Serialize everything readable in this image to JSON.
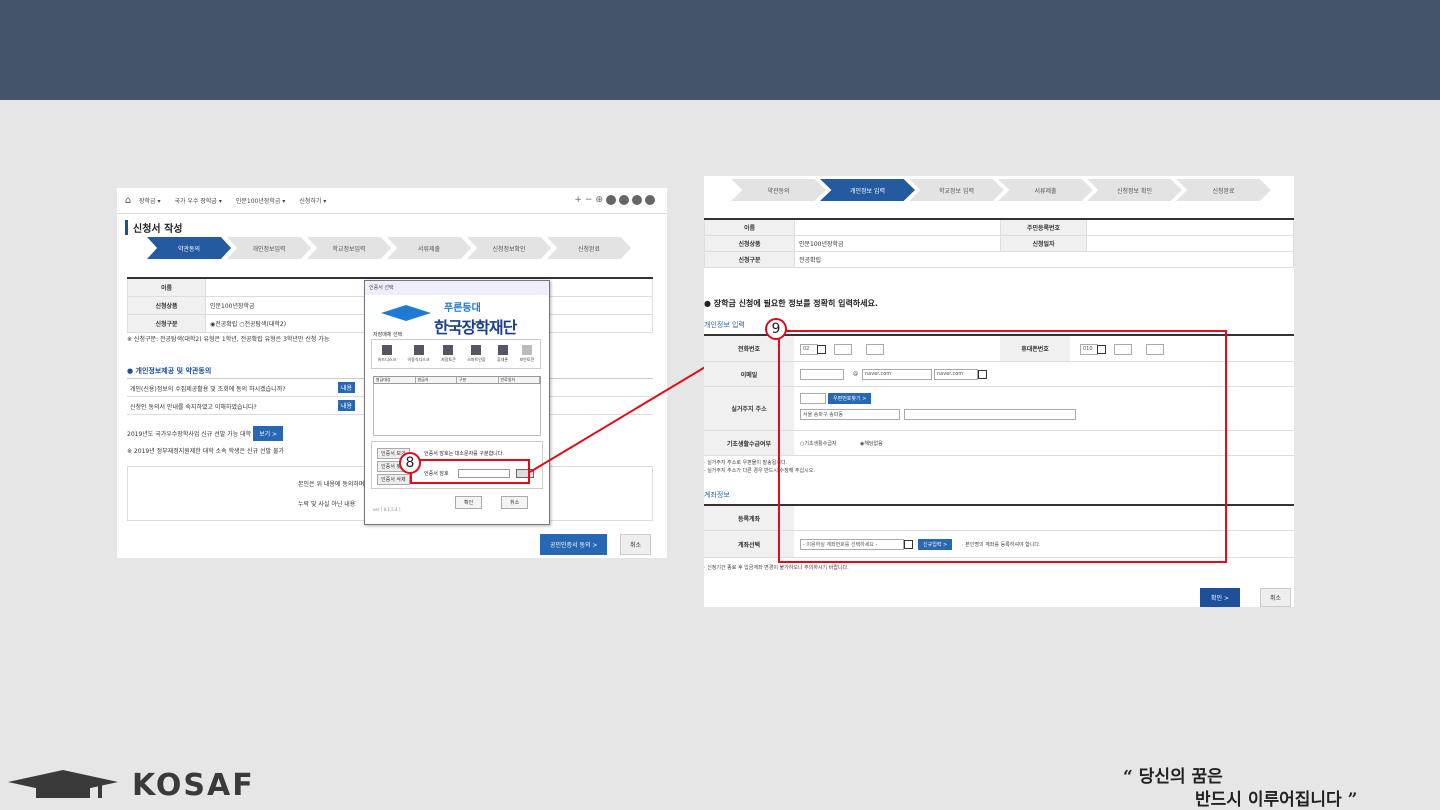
{
  "left_panel": {
    "breadcrumb": [
      "장학금 ▾",
      "국가 우수 장학금 ▾",
      "인문100년장학금 ▾",
      "신청하기 ▾"
    ],
    "crumb_icons": [
      "+",
      "−",
      "⊕"
    ],
    "title": "신청서 작성",
    "steps": [
      "약관동의",
      "개인정보입력",
      "학교정보입력",
      "서류제출",
      "신청정보확인",
      "신청완료"
    ],
    "table": [
      {
        "label": "이름",
        "value": ""
      },
      {
        "label": "신청상품",
        "value": "인문100년장학금"
      },
      {
        "label": "신청구분",
        "value": "◉전공확립 ○전공탐색(대학2)"
      }
    ],
    "note": "※ 신청구분: 전공탐색(대학2) 유형은 1학년, 전공확립 유형은 3학년만 신청 가능",
    "section": "개인정보제공 및 약관동의",
    "agree_rows": [
      "개인(신용)정보의 수집제공활용 및 조회에 동의 하시겠습니까?",
      "신청인 동의서 안내를 숙지하였고 이해하였습니다?"
    ],
    "agree_btn": "내용",
    "note2": "2019년도 국가우수장학사업 신규 선발 가능 대학",
    "view_btn": "보기 >",
    "note3": "※ 2019년 정부재정지원제한 대학 소속 학생은 신규 선발 불가",
    "box_line1": "본인은 위 내용에 동의하며 신청서",
    "box_line2": "누락 및 사실 아닌 내용",
    "cert_btn": "공인인증서 동의 >",
    "cancel_btn": "취소"
  },
  "dialog": {
    "title": "인증서 선택",
    "logo_line1": "푸른등대",
    "logo_line2": "한국장학재단",
    "group_label": "저장매체 선택",
    "devices": [
      "하드디스크",
      "이동식디스크",
      "저장토큰",
      "스마트인증",
      "휴대폰",
      "보안토큰"
    ],
    "columns": [
      "발급대상",
      "발급자",
      "구분",
      "만료일자"
    ],
    "pw_buttons": [
      "인증서 보기",
      "인증서 찾기",
      "인증서 삭제"
    ],
    "pw_hint": "인증서 암호는 대소문자를 구분합니다.",
    "pw_label": "인증서 암호",
    "ok": "확인",
    "cancel": "취소",
    "version": "ver [ 0.1.5.4 ]"
  },
  "right_panel": {
    "steps": [
      "약관동의",
      "개인정보 입력",
      "학교정보 입력",
      "서류제출",
      "신청정보 확인",
      "신청완료"
    ],
    "info": {
      "name_label": "이름",
      "name": "",
      "rrn_label": "주민등록번호",
      "rrn": "",
      "product_label": "신청상품",
      "product": "인문100년장학금",
      "date_label": "신청일자",
      "date": "",
      "type_label": "신청구분",
      "type": "전공확립"
    },
    "section_title": "장학금 신청에 필요한 정보를 정확히 입력하세요.",
    "personal_sub": "개인정보 입력",
    "phone_label": "전화번호",
    "phone_code": "02",
    "mobile_label": "휴대폰번호",
    "mobile_code": "010",
    "email_label": "이메일",
    "email_domain": "naver.com",
    "email_select": "naver.com",
    "address_label": "실거주지 주소",
    "zip_btn": "우편번호찾기 >",
    "address": "서울 송파구 송파동",
    "basic_label": "기초생활수급여부",
    "basic_opt1": "기초생활수급자",
    "basic_opt2": "해당없음",
    "notes": [
      "실거주지 주소로 우편물이 발송됩니다.",
      "실거주지 주소가 다른 경우 반드시 수정해 주십시오."
    ],
    "account_sub": "계좌정보",
    "reg_label": "등록계좌",
    "select_label": "계좌선택",
    "select_placeholder": "- 이용하실 계좌번호를 선택하세요 -",
    "new_btn": "신규입력 >",
    "select_note": "본인명의 계좌를 등록하셔야 합니다.",
    "bottom_note": "신청기간 종료 후 입금계좌 변경이 불가하오니 주의하시기 바랍니다.",
    "ok": "확인 >",
    "cancel": "취소"
  },
  "markers": {
    "m8": "8",
    "m9": "9"
  },
  "brand": {
    "logo": "KOSAF",
    "quote_line1": "당신의 꿈은",
    "quote_line2": "반드시 이루어집니다"
  },
  "colors": {
    "topbar": "#46546b",
    "annotation": "#e10b1b",
    "accent": "#245aa0"
  }
}
